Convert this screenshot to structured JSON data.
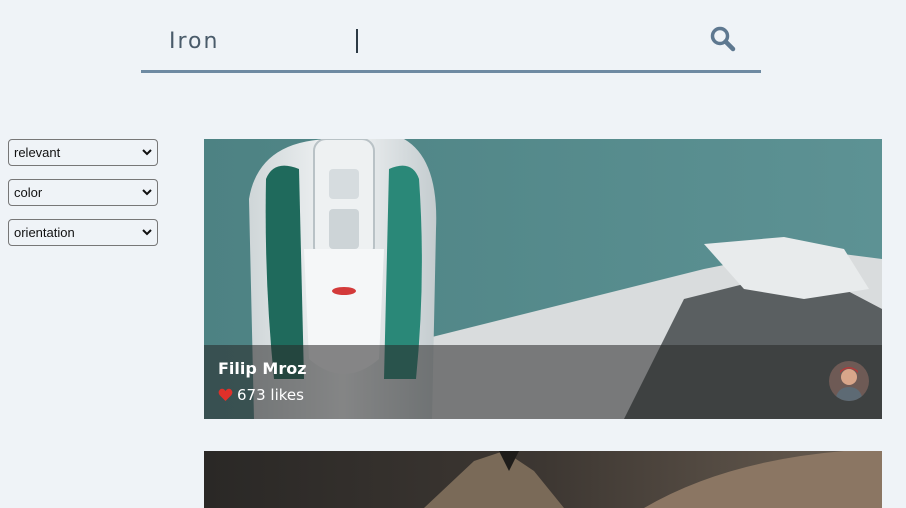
{
  "search": {
    "value": "Iron"
  },
  "filters": [
    {
      "name": "sort",
      "selected": "relevant"
    },
    {
      "name": "color",
      "selected": "color"
    },
    {
      "name": "orientation",
      "selected": "orientation"
    }
  ],
  "results": [
    {
      "author": "Filip Mroz",
      "likes": "673 likes"
    }
  ],
  "colors": {
    "background": "#eff3f7",
    "accent": "#6e8aa2",
    "heart": "#e0302a"
  }
}
